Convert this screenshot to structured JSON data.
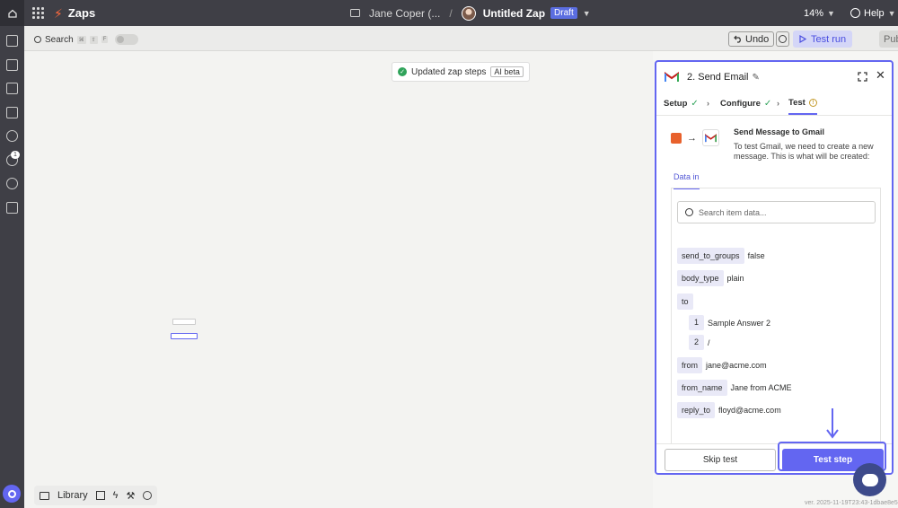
{
  "topbar": {
    "app_name": "Zaps",
    "owner_crumb": "Jane Coper (...",
    "separator": "/",
    "zap_name": "Untitled Zap",
    "status_badge": "Draft",
    "zoom": "14%",
    "help_label": "Help"
  },
  "sidebar": {
    "notification_count": "1"
  },
  "toolbar": {
    "search_label": "Search",
    "shortcut_keys": [
      "⌘",
      "⇧",
      "F"
    ],
    "undo_label": "Undo",
    "test_run_label": "Test run",
    "publish_label": "Publish"
  },
  "canvas": {
    "toast_text": "Updated zap steps",
    "toast_badge": "AI beta"
  },
  "bottom_tools": {
    "library_label": "Library"
  },
  "panel": {
    "step_title": "2. Send Email",
    "tabs": {
      "setup": "Setup",
      "configure": "Configure",
      "test": "Test"
    },
    "send_title": "Send Message to Gmail",
    "send_desc": "To test Gmail, we need to create a new message. This is what will be created:",
    "data_in_tab": "Data in",
    "search_placeholder": "Search item data...",
    "fields": {
      "send_to_groups": {
        "key": "send_to_groups",
        "value": "false"
      },
      "body_type": {
        "key": "body_type",
        "value": "plain"
      },
      "to": {
        "key": "to"
      },
      "to_1": {
        "idx": "1",
        "value": "Sample Answer 2"
      },
      "to_2": {
        "idx": "2",
        "value": "/"
      },
      "from": {
        "key": "from",
        "value": "jane@acme.com"
      },
      "from_name": {
        "key": "from_name",
        "value": "Jane from ACME"
      },
      "reply_to": {
        "key": "reply_to",
        "value": "floyd@acme.com"
      }
    },
    "skip_label": "Skip test",
    "test_step_label": "Test step"
  },
  "version_text": "ver. 2025-11-19T23:43-1dbae8e5",
  "colors": {
    "accent": "#6366f1",
    "topbar_bg": "#3f3f46",
    "brand_orange": "#ff6a3d",
    "success_green": "#2fa35a"
  }
}
